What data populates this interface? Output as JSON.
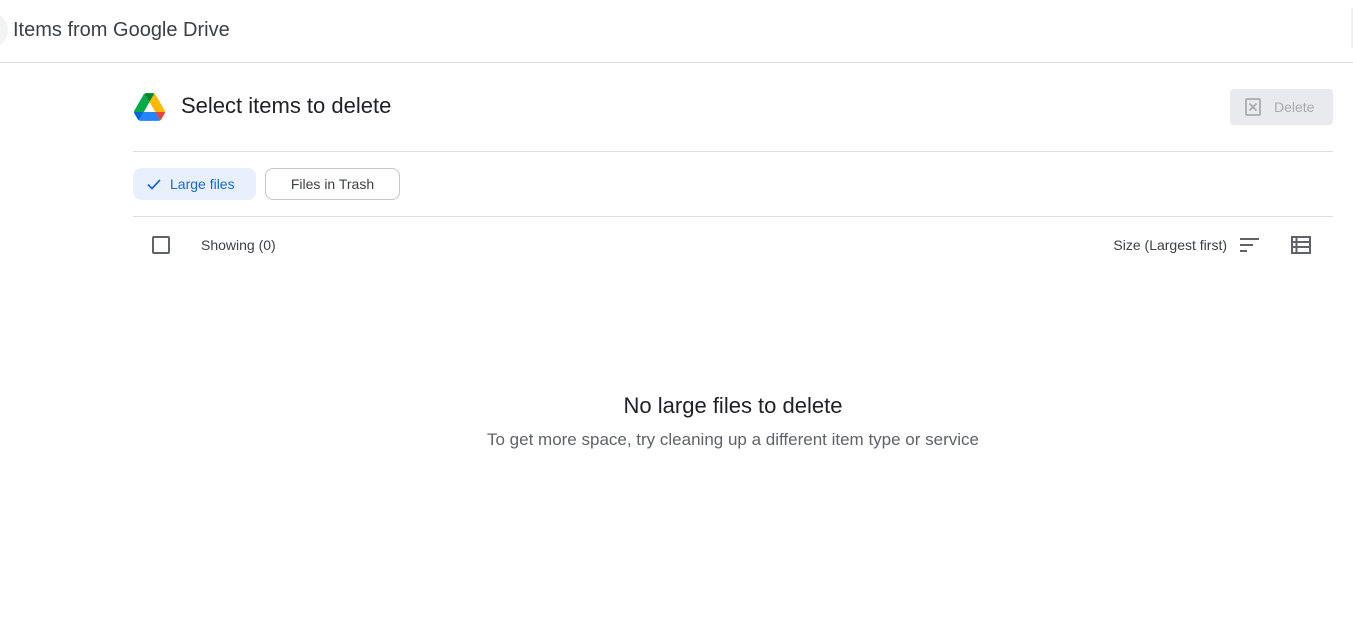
{
  "app": {
    "title": "Items from Google Drive"
  },
  "header": {
    "title": "Select items to delete",
    "logo": "google-drive-icon",
    "delete_label": "Delete"
  },
  "filters": [
    {
      "label": "Large files",
      "selected": true,
      "icon": "check-icon"
    },
    {
      "label": "Files in Trash",
      "selected": false
    }
  ],
  "list": {
    "showing_label": "Showing (0)",
    "sort_label": "Size (Largest first)",
    "sort_icon": "sort-icon",
    "view_icon": "list-view-icon"
  },
  "empty_state": {
    "title": "No large files to delete",
    "subtitle": "To get more space, try cleaning up a different item type or service"
  },
  "colors": {
    "accent": "#1967d2",
    "chip_selected_bg": "#e8f0fe",
    "divider": "#dadce0",
    "disabled_bg": "#e8eaed"
  }
}
